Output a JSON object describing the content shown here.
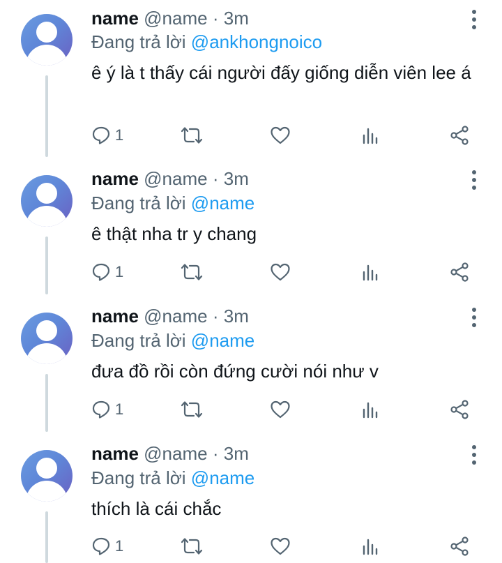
{
  "colors": {
    "accent": "#1d9bf0",
    "muted": "#536471",
    "text": "#0f1419",
    "line": "#cfd9de"
  },
  "icons": [
    "more-vertical-icon",
    "reply-icon",
    "retweet-icon",
    "like-icon",
    "views-icon",
    "share-icon",
    "avatar-icon"
  ],
  "tweets": [
    {
      "name": "name",
      "handle": "@name",
      "separator": "·",
      "time": "3m",
      "reply_prefix": "Đang trả lời",
      "reply_to": "@ankhongnoico",
      "text": "ê ý là t thấy cái người đấy giống diễn viên lee á",
      "reply_count": "1"
    },
    {
      "name": "name",
      "handle": "@name",
      "separator": "·",
      "time": "3m",
      "reply_prefix": "Đang trả lời",
      "reply_to": "@name",
      "text": "ê thật nha tr y chang",
      "reply_count": "1"
    },
    {
      "name": "name",
      "handle": "@name",
      "separator": "·",
      "time": "3m",
      "reply_prefix": "Đang trả lời",
      "reply_to": "@name",
      "text": "đưa đồ rồi còn đứng cười nói như v",
      "reply_count": "1"
    },
    {
      "name": "name",
      "handle": "@name",
      "separator": "·",
      "time": "3m",
      "reply_prefix": "Đang trả lời",
      "reply_to": "@name",
      "text": "thích là cái chắc",
      "reply_count": "1"
    }
  ]
}
